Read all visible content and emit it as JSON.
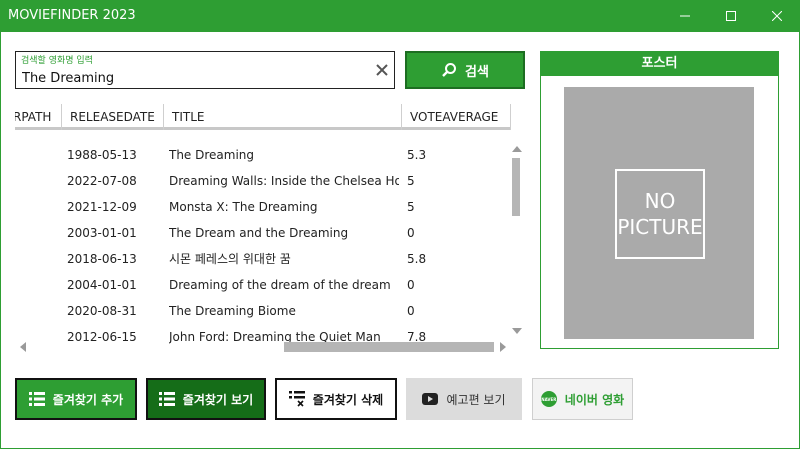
{
  "window": {
    "title": "MOVIEFINDER 2023",
    "titlebar_color": "#2e9e33"
  },
  "search": {
    "hint": "검색할 영화명 입력",
    "value": "The Dreaming",
    "button_label": "검색",
    "clear_icon": "close-icon"
  },
  "grid": {
    "columns": [
      "RPATH",
      "RELEASEDATE",
      "TITLE",
      "VOTEAVERAGE"
    ],
    "rows": [
      {
        "releasedate": "1988-05-13",
        "title": "The Dreaming",
        "voteaverage": "5.3"
      },
      {
        "releasedate": "2022-07-08",
        "title": "Dreaming Walls: Inside the Chelsea Hotel",
        "voteaverage": "5"
      },
      {
        "releasedate": "2021-12-09",
        "title": "Monsta X: The Dreaming",
        "voteaverage": "5"
      },
      {
        "releasedate": "2003-01-01",
        "title": "The Dream and the Dreaming",
        "voteaverage": "0"
      },
      {
        "releasedate": "2018-06-13",
        "title": "시몬 페레스의 위대한 꿈",
        "voteaverage": "5.8"
      },
      {
        "releasedate": "2004-01-01",
        "title": "Dreaming of the dream of the dream",
        "voteaverage": "0"
      },
      {
        "releasedate": "2020-08-31",
        "title": "The Dreaming Biome",
        "voteaverage": "0"
      },
      {
        "releasedate": "2012-06-15",
        "title": "John Ford: Dreaming the Quiet Man",
        "voteaverage": "7.8"
      }
    ]
  },
  "poster": {
    "title": "포스터",
    "placeholder_line1": "NO",
    "placeholder_line2": "PICTURE"
  },
  "buttons": {
    "add_favorite": "즐겨찾기 추가",
    "view_favorite": "즐겨찾기 보기",
    "delete_favorite": "즐겨찾기 삭제",
    "trailer": "예고편 보기",
    "naver": "네이버 영화",
    "naver_logo_text": "NAVER"
  },
  "colors": {
    "accent": "#2e9e33",
    "accent_dark": "#156d18",
    "disabled": "#dcdcdc"
  }
}
